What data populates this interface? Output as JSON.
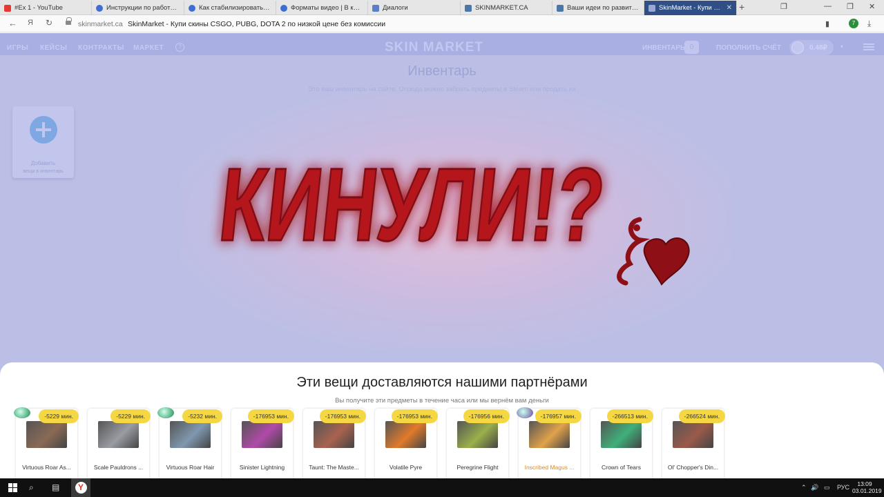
{
  "browser": {
    "tabs": [
      {
        "label": "#Ex 1 - YouTube",
        "favicon": "youtube-icon",
        "color": "#e53935"
      },
      {
        "label": "Инструкции по работе с м",
        "favicon": "globe-icon",
        "color": "#3d6fd1"
      },
      {
        "label": "Как стабилизировать виде",
        "favicon": "globe-icon",
        "color": "#3d6fd1"
      },
      {
        "label": "Форматы видео | В каком",
        "favicon": "globe-icon",
        "color": "#3d6fd1"
      },
      {
        "label": "Диалоги",
        "favicon": "chat-icon",
        "color": "#5b7fc7"
      },
      {
        "label": "SKINMARKET.CA",
        "favicon": "vk-icon",
        "color": "#4a76a8"
      },
      {
        "label": "Ваши идеи по развитию са",
        "favicon": "vk-icon",
        "color": "#4a76a8"
      },
      {
        "label": "SkinMarket - Купи скины",
        "favicon": "skinmarket-icon",
        "color": "#9aa8d8",
        "active": true
      }
    ],
    "close_tab_glyph": "✕",
    "new_tab_glyph": "+",
    "window_controls": [
      "❐",
      "—",
      "❐",
      "✕"
    ],
    "address": {
      "back": "←",
      "ya": "Я",
      "reload": "↻",
      "domain": "skinmarket.ca",
      "page_title": "SkinMarket - Купи скины CSGO, PUBG, DOTA 2 по низкой цене без комиссии",
      "bookmark": "▮",
      "extension_badge": "7",
      "download": "⤓"
    }
  },
  "site": {
    "nav": [
      "ИГРЫ",
      "КЕЙСЫ",
      "КОНТРАКТЫ",
      "МАРКЕТ"
    ],
    "help_glyph": "?",
    "logo": "SKIN   MARKET",
    "inventory_label": "ИНВЕНТАРЬ",
    "inventory_count": "0",
    "topup_label": "ПОПОЛНИТЬ СЧЁТ",
    "balance": "0.48₽",
    "caret": "▾",
    "title": "Инвентарь",
    "subtitle": "Это ваш инвентарь на сайте. Отсюда можно забрать предметы в Steam или продать их",
    "add_card": {
      "line1": "Добавить",
      "line2": "вещи в инвентарь"
    },
    "overlay_text": "КИНУЛИ!?"
  },
  "partners": {
    "title": "Эти вещи доставляются нашими партнёрами",
    "subtitle": "Вы получите эти предметы в течение часа или мы вернём вам деньги",
    "items": [
      {
        "price": "-5229 мин.",
        "name": "Virtuous Roar As...",
        "gem": "#1f8a4c",
        "thumb": "#8a6a55"
      },
      {
        "price": "-5229 мин.",
        "name": "Scale Pauldrons ...",
        "gem": "",
        "thumb": "#9a9ca4"
      },
      {
        "price": "-5232 мин.",
        "name": "Virtuous Roar Hair",
        "gem": "#1f8a4c",
        "thumb": "#7f98b0"
      },
      {
        "price": "-176953 мин.",
        "name": "Sinister Lightning",
        "gem": "",
        "thumb": "#b04aa8"
      },
      {
        "price": "-176953 мин.",
        "name": "Taunt: The Maste...",
        "gem": "",
        "thumb": "#a8634e"
      },
      {
        "price": "-176953 мин.",
        "name": "Volatile Pyre",
        "gem": "",
        "thumb": "#e07a2b"
      },
      {
        "price": "-176956 мин.",
        "name": "Peregrine Flight",
        "gem": "",
        "thumb": "#9ab04a"
      },
      {
        "price": "-176957 мин.",
        "name": "Inscribed Magus ...",
        "gem": "#6a4aa0",
        "thumb": "#e0a24a",
        "highlight": true
      },
      {
        "price": "-266513 мин.",
        "name": "Crown of Tears",
        "gem": "",
        "thumb": "#3fb07a"
      },
      {
        "price": "-266524 мин.",
        "name": "Ol' Chopper's Din...",
        "gem": "",
        "thumb": "#9a5a4a"
      }
    ]
  },
  "taskbar": {
    "search_glyph": "⌕",
    "files_glyph": "▤",
    "tray": {
      "up": "⌃",
      "sound": "🔊",
      "kbd": "▭",
      "lang": "РУС"
    },
    "time": "13:09",
    "date": "03.01.2019"
  },
  "colors": {
    "accent": "#2f4f86",
    "badge": "#f5d744",
    "overlay": "#b5141c",
    "highlight_text": "#e08a20"
  }
}
